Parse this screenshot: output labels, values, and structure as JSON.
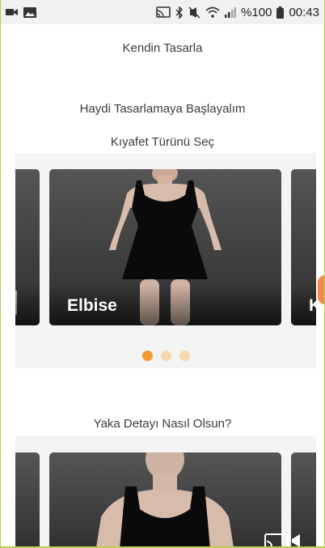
{
  "statusbar": {
    "battery_text": "%100",
    "time": "00:43",
    "icons": [
      "video-camera-icon",
      "image-icon",
      "cast-icon",
      "bluetooth-icon",
      "mute-icon",
      "wifi-icon",
      "signal-icon",
      "battery-icon"
    ]
  },
  "page": {
    "title": "Kendin Tasarla",
    "subtitle": "Haydi Tasarlamaya Başlayalım"
  },
  "garment_section": {
    "heading": "Kıyafet Türünü Seç",
    "cards": [
      {
        "label": ""
      },
      {
        "label": "Elbise"
      },
      {
        "label": "K"
      }
    ],
    "page_count": 3,
    "active_index": 0
  },
  "collar_section": {
    "heading": "Yaka Detayı Nasıl Olsun?",
    "cards": [
      {
        "label": ""
      },
      {
        "label": ""
      },
      {
        "label": ""
      }
    ]
  },
  "colors": {
    "accent": "#f39a33",
    "dot_inactive": "#f7d7ae",
    "frame_border": "#b9cf45"
  }
}
